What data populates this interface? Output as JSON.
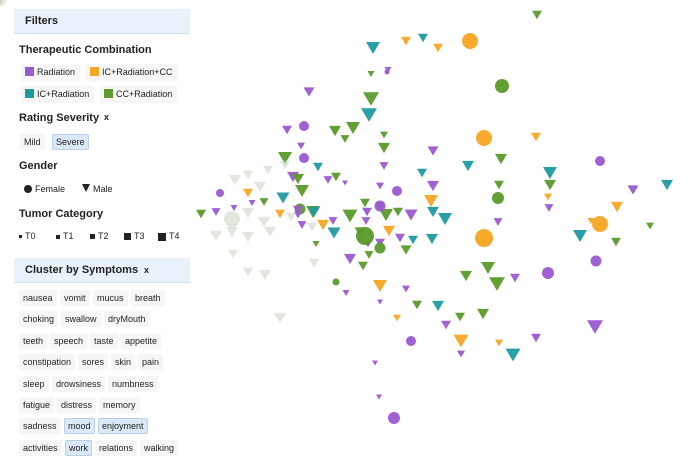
{
  "filters": {
    "title": "Filters",
    "therapeutic": {
      "title": "Therapeutic Combination",
      "items": [
        {
          "label": "Radiation",
          "color": "#9b59d0"
        },
        {
          "label": "IC+Radiation+CC",
          "color": "#f5a623"
        },
        {
          "label": "IC+Radiation",
          "color": "#1f9aa3"
        },
        {
          "label": "CC+Radiation",
          "color": "#5a9a2a"
        }
      ]
    },
    "rating": {
      "title": "Rating Severity",
      "clear": "x",
      "options": [
        "Mild",
        "Severe"
      ],
      "selected": "Severe"
    },
    "gender": {
      "title": "Gender",
      "options": [
        {
          "label": "Female",
          "icon": "circle-icon"
        },
        {
          "label": "Male",
          "icon": "triangle-icon"
        }
      ]
    },
    "tumor": {
      "title": "Tumor Category",
      "options": [
        "T0",
        "T1",
        "T2",
        "T3",
        "T4"
      ]
    }
  },
  "cluster": {
    "title": "Cluster by Symptoms",
    "clear": "x",
    "symptoms": [
      {
        "label": "nausea",
        "active": false
      },
      {
        "label": "vomit",
        "active": false
      },
      {
        "label": "mucus",
        "active": false
      },
      {
        "label": "breath",
        "active": false
      },
      {
        "label": "choking",
        "active": false
      },
      {
        "label": "swallow",
        "active": false
      },
      {
        "label": "dryMouth",
        "active": false
      },
      {
        "label": "teeth",
        "active": false
      },
      {
        "label": "speech",
        "active": false
      },
      {
        "label": "taste",
        "active": false
      },
      {
        "label": "appetite",
        "active": false
      },
      {
        "label": "constipation",
        "active": false
      },
      {
        "label": "sores",
        "active": false
      },
      {
        "label": "skin",
        "active": false
      },
      {
        "label": "pain",
        "active": false
      },
      {
        "label": "sleep",
        "active": false
      },
      {
        "label": "drowsiness",
        "active": false
      },
      {
        "label": "numbness",
        "active": false
      },
      {
        "label": "fatigue",
        "active": false
      },
      {
        "label": "distress",
        "active": false
      },
      {
        "label": "memory",
        "active": false
      },
      {
        "label": "sadness",
        "active": false
      },
      {
        "label": "mood",
        "active": true
      },
      {
        "label": "enjoyment",
        "active": true
      },
      {
        "label": "activities",
        "active": false
      },
      {
        "label": "work",
        "active": true
      },
      {
        "label": "relations",
        "active": false
      },
      {
        "label": "walking",
        "active": false
      }
    ]
  },
  "colors": {
    "P": "#9b59d0",
    "O": "#f5a623",
    "T": "#1f9aa3",
    "G": "#5a9a2a",
    "F": "#c9d3bf"
  },
  "patients": [
    [
      "T",
      0,
      "G",
      10
    ],
    [
      "T",
      0,
      "T",
      14
    ],
    [
      "T",
      0,
      "O",
      10
    ],
    [
      "T",
      0,
      "T",
      10
    ],
    [
      "T",
      0,
      "O",
      10
    ],
    [
      "C",
      0,
      "O",
      16
    ],
    [
      "C",
      0,
      "G",
      14
    ],
    [
      "C",
      0,
      "P",
      5
    ],
    [
      "T",
      0,
      "G",
      7
    ],
    [
      "T",
      0,
      "P",
      7
    ],
    [
      "T",
      0,
      "G",
      16
    ],
    [
      "T",
      0,
      "T",
      16
    ],
    [
      "T",
      0,
      "P",
      11
    ],
    [
      "T",
      0,
      "G",
      12
    ],
    [
      "T",
      0,
      "P",
      10
    ],
    [
      "C",
      0,
      "P",
      10
    ],
    [
      "T",
      0,
      "G",
      14
    ],
    [
      "T",
      0,
      "G",
      8
    ],
    [
      "T",
      0,
      "P",
      8
    ],
    [
      "T",
      0,
      "G",
      9
    ],
    [
      "C",
      0,
      "O",
      16
    ],
    [
      "T",
      0,
      "O",
      10
    ],
    [
      "T",
      0,
      "G",
      12
    ],
    [
      "C",
      0,
      "P",
      10
    ],
    [
      "T",
      0,
      "P",
      11
    ],
    [
      "T",
      0,
      "G",
      14
    ],
    [
      "C",
      0,
      "P",
      10
    ],
    [
      "T",
      0,
      "T",
      12
    ],
    [
      "T",
      0,
      "G",
      12
    ],
    [
      "T",
      0,
      "T",
      10
    ],
    [
      "T",
      0,
      "P",
      9
    ],
    [
      "T",
      0,
      "P",
      12
    ],
    [
      "T",
      0,
      "G",
      12
    ],
    [
      "T",
      0,
      "G",
      10
    ],
    [
      "T",
      0,
      "P",
      9
    ],
    [
      "T",
      0,
      "P",
      6
    ],
    [
      "T",
      0,
      "T",
      10
    ],
    [
      "T",
      0,
      "T",
      14
    ],
    [
      "T",
      0,
      "G",
      12
    ],
    [
      "T",
      0,
      "P",
      11
    ],
    [
      "T",
      0,
      "O",
      14
    ],
    [
      "T",
      0,
      "T",
      12
    ],
    [
      "T",
      0,
      "P",
      13
    ],
    [
      "T",
      0,
      "P",
      12
    ],
    [
      "T",
      0,
      "T",
      14
    ],
    [
      "T",
      0,
      "G",
      14
    ],
    [
      "T",
      0,
      "P",
      8
    ],
    [
      "C",
      0,
      "P",
      10
    ],
    [
      "T",
      0,
      "G",
      10
    ],
    [
      "T",
      0,
      "O",
      8
    ],
    [
      "T",
      0,
      "T",
      13
    ],
    [
      "C",
      0,
      "G",
      11
    ],
    [
      "T",
      0,
      "G",
      14
    ],
    [
      "T",
      0,
      "P",
      10
    ],
    [
      "T",
      0,
      "T",
      12
    ],
    [
      "T",
      0,
      "P",
      9
    ],
    [
      "T",
      0,
      "P",
      9
    ],
    [
      "T",
      0,
      "O",
      7
    ],
    [
      "C",
      0,
      "O",
      16
    ],
    [
      "T",
      0,
      "T",
      14
    ],
    [
      "T",
      0,
      "O",
      12
    ],
    [
      "T",
      0,
      "P",
      9
    ],
    [
      "T",
      0,
      "G",
      11
    ],
    [
      "T",
      0,
      "T",
      13
    ],
    [
      "T",
      0,
      "G",
      15
    ],
    [
      "T",
      0,
      "G",
      14
    ],
    [
      "T",
      0,
      "G",
      10
    ],
    [
      "T",
      0,
      "P",
      9
    ],
    [
      "T",
      0,
      "G",
      10
    ],
    [
      "T",
      0,
      "O",
      12
    ],
    [
      "T",
      0,
      "P",
      10
    ],
    [
      "T",
      0,
      "G",
      11
    ],
    [
      "T",
      0,
      "T",
      10
    ],
    [
      "T",
      0,
      "P",
      8
    ],
    [
      "T",
      0,
      "G",
      9
    ],
    [
      "T",
      0,
      "P",
      10
    ],
    [
      "T",
      0,
      "O",
      12
    ],
    [
      "T",
      0,
      "T",
      12
    ],
    [
      "T",
      0,
      "O",
      12
    ],
    [
      "T",
      0,
      "G",
      8
    ],
    [
      "T",
      0,
      "P",
      9
    ],
    [
      "T",
      0,
      "T",
      12
    ],
    [
      "C",
      0,
      "G",
      12
    ],
    [
      "T",
      0,
      "P",
      9
    ],
    [
      "T",
      0,
      "G",
      10
    ],
    [
      "C",
      0,
      "P",
      11
    ],
    [
      "T",
      0,
      "G",
      14
    ],
    [
      "T",
      0,
      "G",
      16
    ],
    [
      "T",
      0,
      "P",
      10
    ],
    [
      "C",
      0,
      "P",
      12
    ],
    [
      "T",
      0,
      "O",
      14
    ],
    [
      "T",
      0,
      "G",
      12
    ],
    [
      "T",
      0,
      "G",
      10
    ],
    [
      "T",
      0,
      "P",
      7
    ],
    [
      "T",
      0,
      "G",
      7
    ],
    [
      "C",
      0,
      "G",
      7
    ],
    [
      "T",
      0,
      "P",
      8
    ],
    [
      "C",
      0,
      "P",
      10
    ],
    [
      "T",
      0,
      "P",
      8
    ],
    [
      "T",
      0,
      "O",
      8
    ],
    [
      "T",
      0,
      "P",
      6
    ],
    [
      "T",
      0,
      "G",
      10
    ],
    [
      "T",
      0,
      "T",
      12
    ],
    [
      "T",
      0,
      "G",
      10
    ],
    [
      "T",
      0,
      "P",
      12
    ],
    [
      "T",
      0,
      "P",
      10
    ],
    [
      "T",
      0,
      "O",
      15
    ],
    [
      "T",
      0,
      "T",
      15
    ],
    [
      "T",
      0,
      "P",
      16
    ],
    [
      "T",
      0,
      "P",
      10
    ],
    [
      "T",
      0,
      "P",
      10
    ],
    [
      "T",
      0,
      "G",
      12
    ],
    [
      "T",
      0,
      "O",
      8
    ],
    [
      "T",
      0,
      "P",
      6
    ],
    [
      "T",
      0,
      "P",
      6
    ],
    [
      "C",
      0,
      "P",
      12
    ],
    [
      "C",
      0,
      "O",
      18
    ],
    [
      "C",
      0,
      "G",
      18
    ],
    [
      "C",
      0,
      "P",
      11
    ],
    [
      "C",
      0,
      "G",
      11
    ],
    [
      "T",
      0,
      "P",
      9
    ],
    [
      "T",
      0,
      "P",
      7
    ],
    [
      "T",
      0,
      "G",
      10
    ],
    [
      "C",
      0,
      "P",
      8
    ],
    [
      "T",
      0,
      "O",
      10
    ],
    [
      "T",
      0,
      "G",
      9
    ],
    [
      "T",
      0,
      "O",
      10
    ],
    [
      "T",
      0,
      "P",
      8
    ],
    [
      "T",
      0,
      "P",
      7
    ],
    [
      "T",
      0,
      "F",
      12
    ],
    [
      "T",
      0,
      "F",
      12
    ],
    [
      "T",
      0,
      "F",
      12
    ],
    [
      "T",
      0,
      "F",
      12
    ],
    [
      "T",
      0,
      "F",
      10
    ],
    [
      "T",
      0,
      "F",
      10
    ],
    [
      "T",
      0,
      "F",
      10
    ],
    [
      "T",
      0,
      "F",
      10
    ],
    [
      "T",
      0,
      "F",
      10
    ],
    [
      "T",
      0,
      "F",
      10
    ],
    [
      "T",
      0,
      "F",
      12
    ],
    [
      "T",
      0,
      "F",
      12
    ],
    [
      "T",
      0,
      "F",
      10
    ],
    [
      "T",
      0,
      "F",
      10
    ],
    [
      "T",
      0,
      "F",
      12
    ],
    [
      "T",
      0,
      "F",
      12
    ],
    [
      "T",
      0,
      "F",
      12
    ],
    [
      "T",
      0,
      "F",
      12
    ],
    [
      "C",
      0,
      "F",
      16
    ],
    [
      "C",
      0,
      "F",
      12
    ],
    [
      "T",
      0,
      "F",
      10
    ],
    [
      "T",
      0,
      "F",
      10
    ],
    [
      "T",
      0,
      "F",
      10
    ],
    [
      "T",
      0,
      "F",
      10
    ],
    [
      "T",
      0,
      "F",
      10
    ],
    [
      "T",
      0,
      "F",
      10
    ],
    [
      "T",
      0,
      "F",
      10
    ],
    [
      "T",
      0,
      "F",
      12
    ]
  ]
}
